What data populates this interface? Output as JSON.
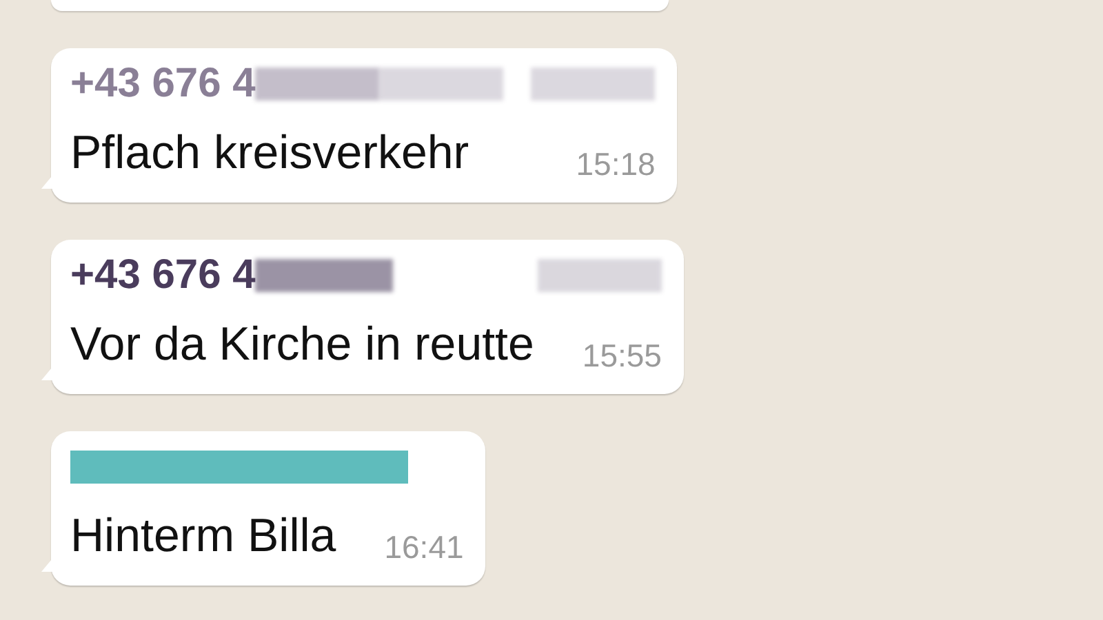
{
  "messages": [
    {
      "sender": "+43 676 4",
      "color": "#8a7f96",
      "text": "Pflach kreisverkehr",
      "time": "15:18"
    },
    {
      "sender": "+43 676 4",
      "color": "#4a3c5c",
      "text": "Vor da Kirche in reutte",
      "time": "15:55"
    },
    {
      "color": "#5fbcbc",
      "text": "Hinterm Billa",
      "time": "16:41"
    }
  ]
}
